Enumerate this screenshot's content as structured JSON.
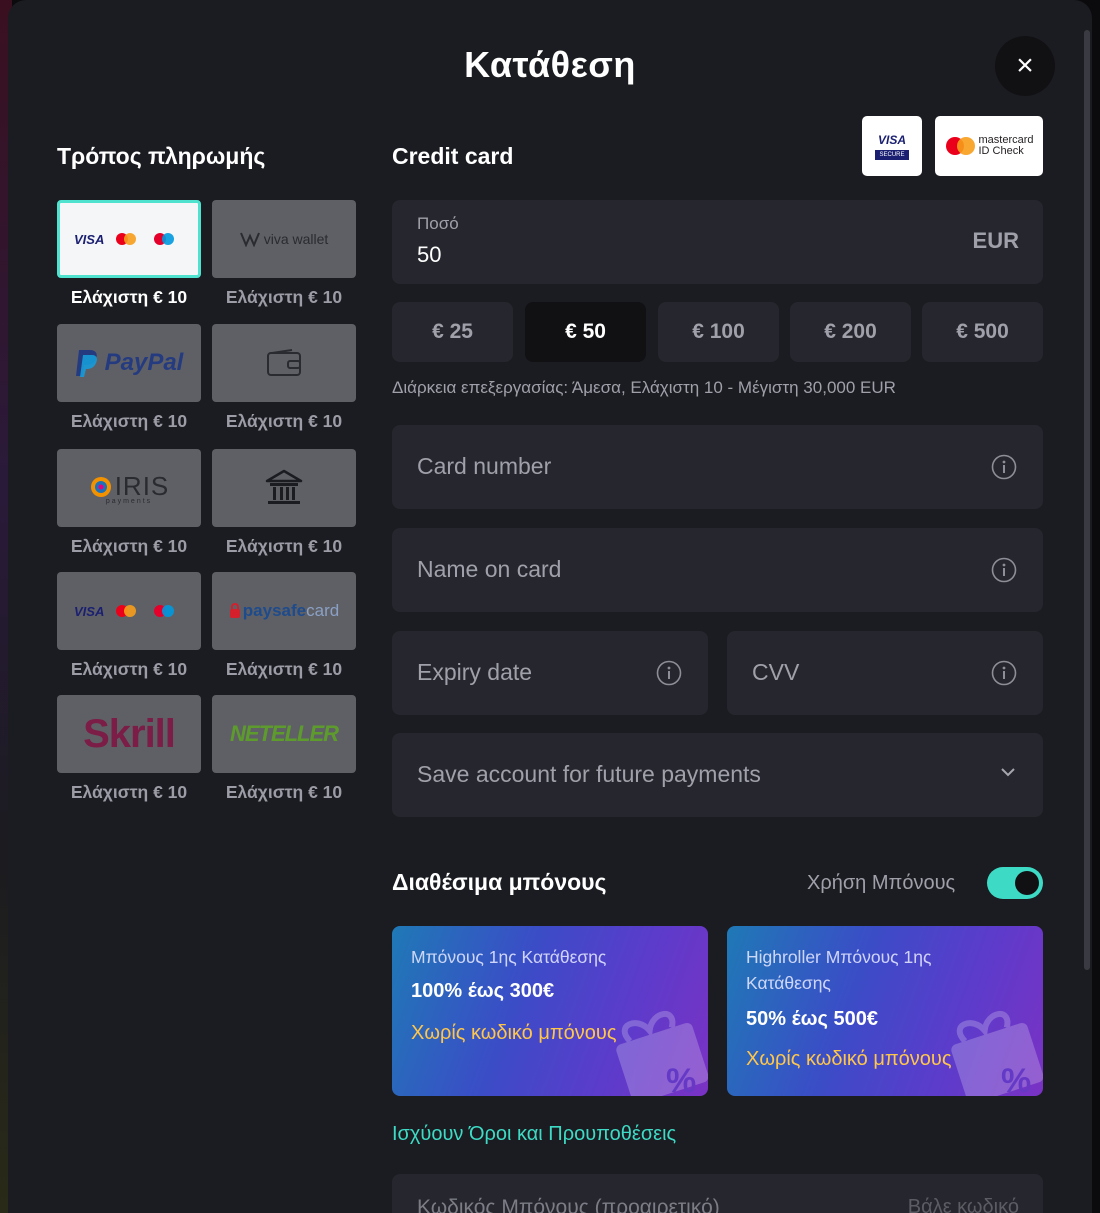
{
  "modal": {
    "title": "Κατάθεση",
    "close_label": "×"
  },
  "payment_methods": {
    "heading": "Τρόπος πληρωμής",
    "items": [
      {
        "name": "cards",
        "icon": "visa-mastercard-maestro-logos",
        "min_label": "Ελάχιστη € 10",
        "selected": true
      },
      {
        "name": "viva-wallet",
        "icon": "viva-wallet-logo",
        "logo_text": "viva wallet",
        "min_label": "Ελάχιστη € 10"
      },
      {
        "name": "paypal",
        "icon": "paypal-logo",
        "logo_text": "PayPal",
        "min_label": "Ελάχιστη € 10"
      },
      {
        "name": "wallet",
        "icon": "wallet-icon",
        "min_label": "Ελάχιστη € 10"
      },
      {
        "name": "iris",
        "icon": "iris-logo",
        "logo_text": "IRIS",
        "logo_sub": "payments",
        "min_label": "Ελάχιστη € 10"
      },
      {
        "name": "bank",
        "icon": "bank-icon",
        "min_label": "Ελάχιστη € 10"
      },
      {
        "name": "cards-2",
        "icon": "visa-mastercard-maestro-logos",
        "min_label": "Ελάχιστη € 10"
      },
      {
        "name": "paysafecard",
        "icon": "paysafecard-logo",
        "logo_text": "paysafe",
        "logo_text2": "card",
        "min_label": "Ελάχιστη € 10"
      },
      {
        "name": "skrill",
        "icon": "skrill-logo",
        "logo_text": "Skrill",
        "min_label": "Ελάχιστη € 10"
      },
      {
        "name": "neteller",
        "icon": "neteller-logo",
        "logo_text": "NETELLER",
        "min_label": "Ελάχιστη € 10"
      }
    ]
  },
  "credit_card": {
    "heading": "Credit card",
    "badges": [
      {
        "name": "visa-secure",
        "text": "VISA",
        "sub": "SECURE"
      },
      {
        "name": "mastercard-id-check",
        "text": "mastercard",
        "sub": "ID Check"
      }
    ],
    "amount": {
      "label": "Ποσό",
      "value": "50",
      "currency": "EUR"
    },
    "quick_amounts": [
      "€ 25",
      "€ 50",
      "€ 100",
      "€ 200",
      "€ 500"
    ],
    "active_quick_amount": "€ 50",
    "processing_info": "Διάρκεια επεξεργασίας: Άμεσα, Ελάχιστη 10 - Μέγιστη 30,000 EUR",
    "fields": {
      "card_number": "Card number",
      "name_on_card": "Name on card",
      "expiry_date": "Expiry date",
      "cvv": "CVV",
      "save_account": "Save account for future payments"
    }
  },
  "bonuses": {
    "heading": "Διαθέσιμα μπόνους",
    "toggle_label": "Χρήση Μπόνους",
    "toggle_on": true,
    "cards": [
      {
        "title": "Μπόνους 1ης Κατάθεσης",
        "offer": "100% έως 300€",
        "code_text": "Χωρίς κωδικό μπόνους"
      },
      {
        "title": "Highroller Μπόνους 1ης Κατάθεσης",
        "offer": "50% έως 500€",
        "code_text": "Χωρίς κωδικό μπόνους"
      }
    ],
    "terms_link": "Ισχύουν Όροι και Προυποθέσεις",
    "promo_placeholder": "Κωδικός Μπόνους (προαιρετικό)",
    "promo_add": "Βάλε κωδικό"
  },
  "colors": {
    "accent": "#3ddbc5",
    "bonus_code": "#ffc64a",
    "modal_bg": "#1b1c21",
    "field_bg": "#26272e"
  }
}
